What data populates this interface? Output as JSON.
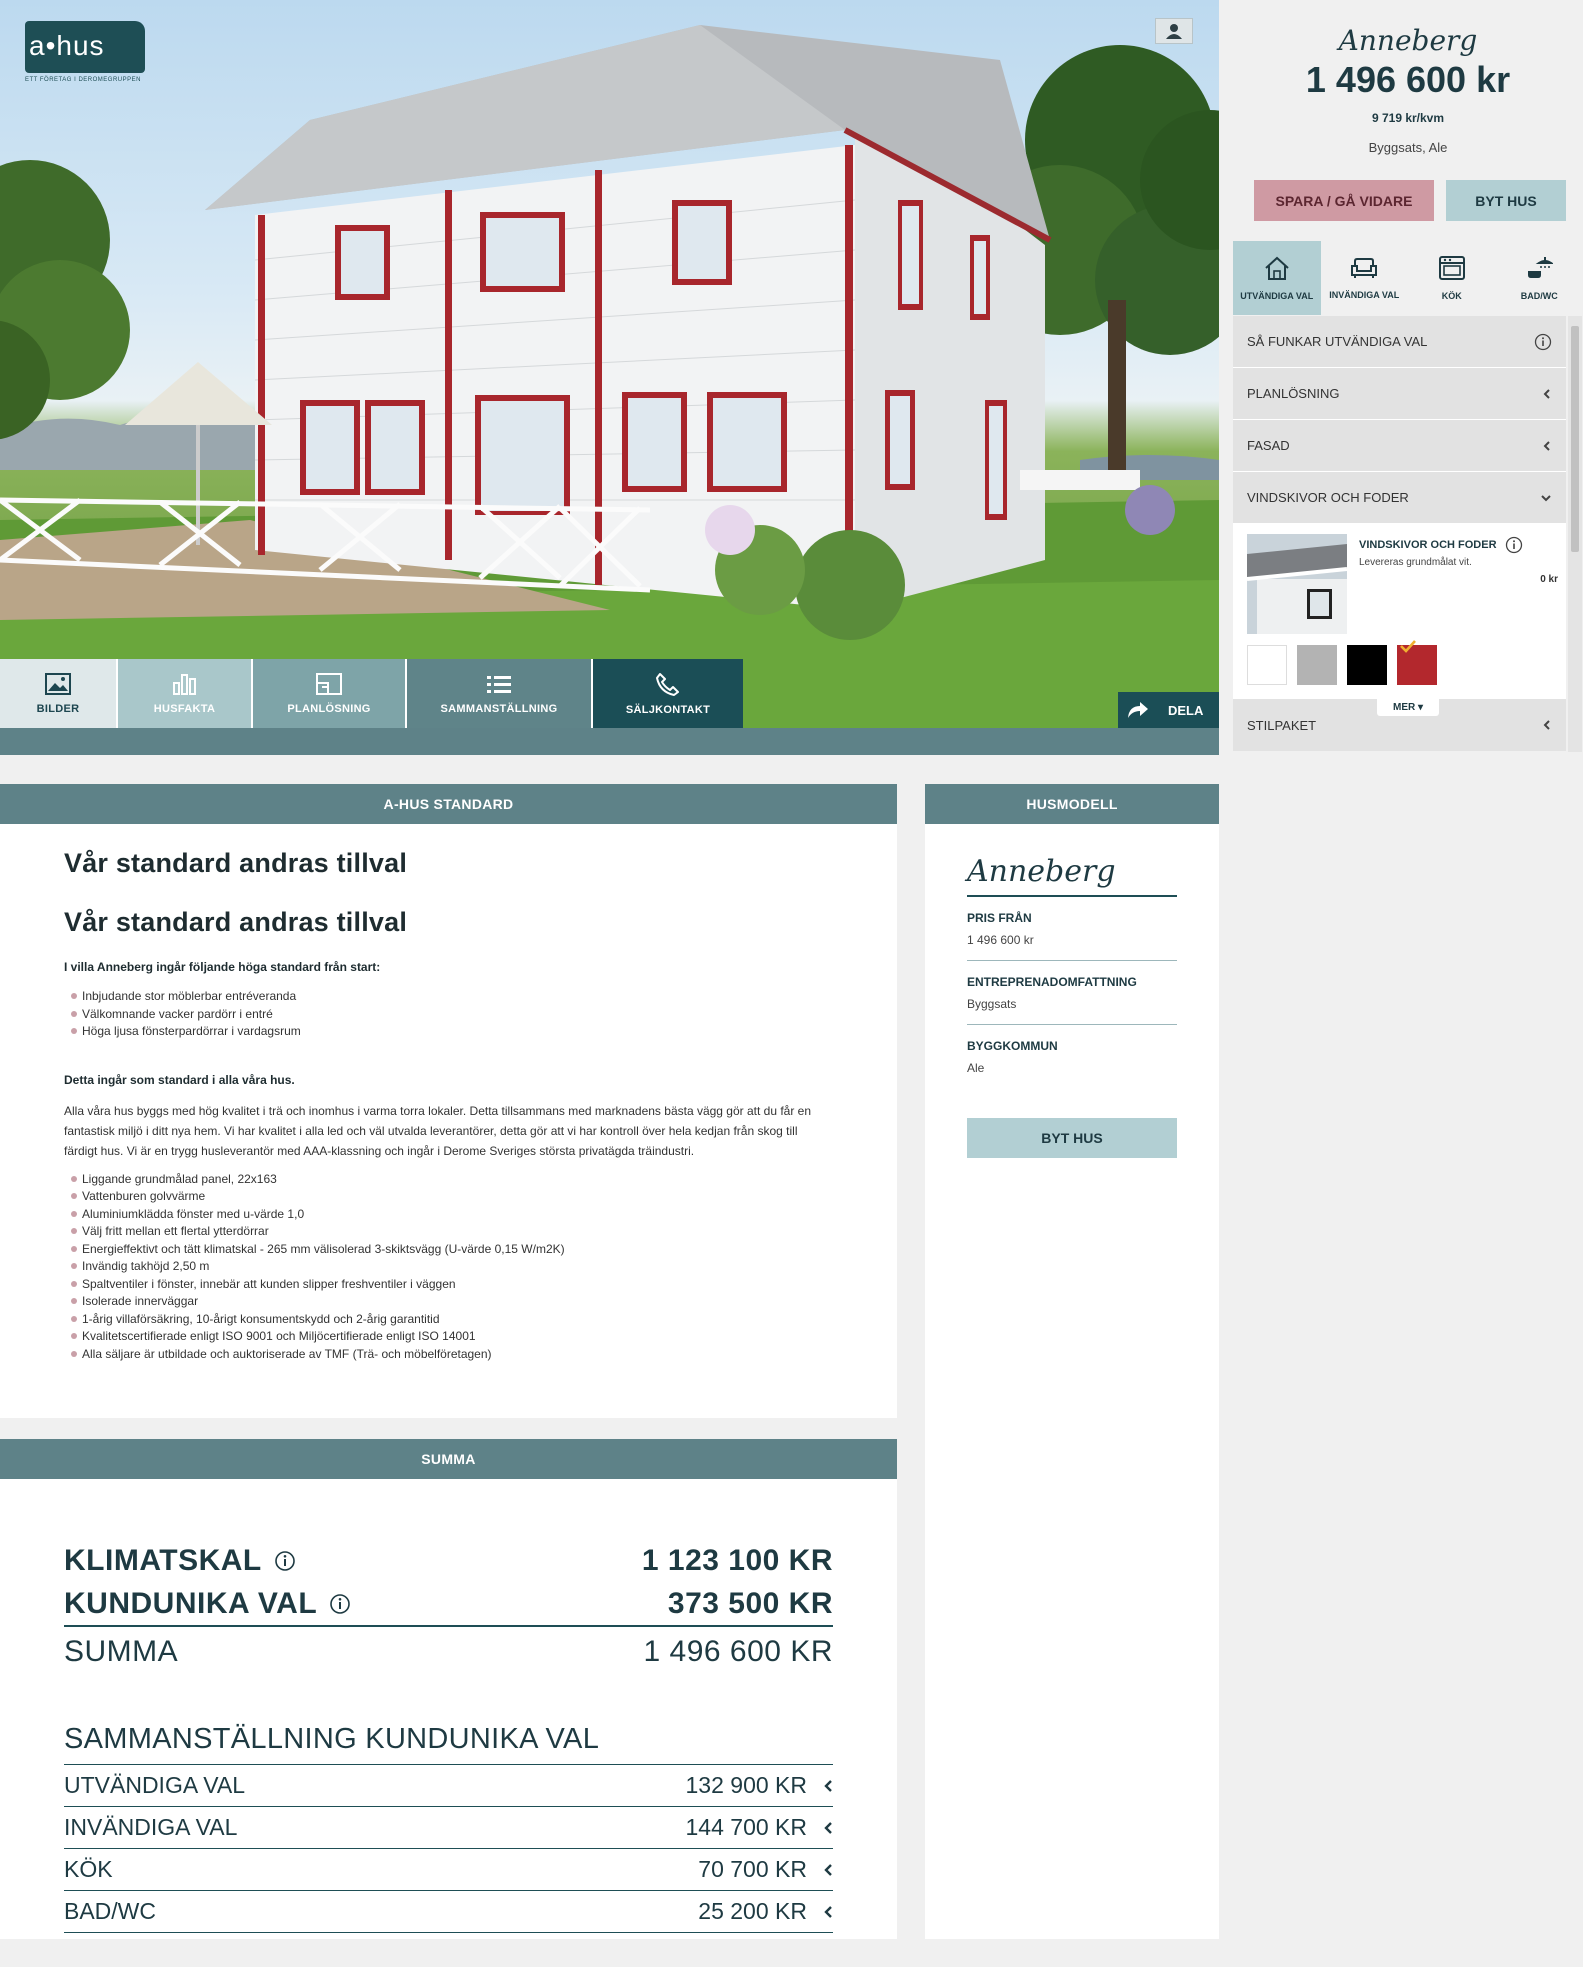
{
  "brand": {
    "logo_text": "a•hus",
    "logo_tagline": "ETT FÖRETAG I DEROMEGRUPPEN"
  },
  "hero_tabs": [
    {
      "label": "BILDER",
      "icon": "image-icon"
    },
    {
      "label": "HUSFAKTA",
      "icon": "bar-chart-icon"
    },
    {
      "label": "PLANLÖSNING",
      "icon": "floorplan-icon"
    },
    {
      "label": "SAMMANSTÄLLNING",
      "icon": "list-icon"
    },
    {
      "label": "SÄLJKONTAKT",
      "icon": "phone-icon"
    }
  ],
  "share": {
    "label": "DELA",
    "icon": "share-arrow-icon"
  },
  "standard": {
    "header": "A-HUS STANDARD",
    "heading1": "Vår standard andras tillval",
    "heading2": "Vår standard andras tillval",
    "intro_bold": "I villa Anneberg ingår följande höga standard från start:",
    "intro_list": [
      "Inbjudande stor möblerbar entréveranda",
      "Välkomnande vacker pardörr i entré",
      "Höga ljusa fönsterpardörrar i vardagsrum"
    ],
    "std_bold": "Detta ingår som standard i alla våra hus.",
    "paragraph": "Alla våra hus byggs med hög kvalitet i trä och inomhus i varma torra lokaler. Detta tillsammans med marknadens bästa vägg gör att du får en fantastisk miljö i ditt nya hem. Vi har kvalitet i alla led och väl utvalda leverantörer, detta gör att vi har kontroll över hela kedjan från skog till färdigt hus. Vi är en trygg husleverantör med AAA-klassning och ingår i Derome Sveriges största privatägda träindustri.",
    "std_list": [
      "Liggande grundmålad panel, 22x163",
      "Vattenburen golvvärme",
      "Aluminiumklädda fönster med u-värde 1,0",
      "Välj fritt mellan ett flertal ytterdörrar",
      "Energieffektivt och tätt klimatskal - 265 mm välisolerad 3-skiktsvägg (U-värde 0,15 W/m2K)",
      "Invändig takhöjd 2,50 m",
      "Spaltventiler i fönster, innebär att kunden slipper freshventiler i väggen",
      "Isolerade innerväggar",
      "1-årig villaförsäkring, 10-årigt konsumentskydd och 2-årig garantitid",
      "Kvalitetscertifierade enligt ISO 9001 och Miljöcertifierade enligt ISO 14001",
      "Alla säljare är utbildade och auktoriserade av TMF (Trä- och möbelföretagen)"
    ]
  },
  "husmodell": {
    "header": "HUSMODELL",
    "name": "Anneberg",
    "pris_label": "PRIS FRÅN",
    "pris_value": "1 496 600 kr",
    "entre_label": "ENTREPRENADOMFATTNING",
    "entre_value": "Byggsats",
    "kommun_label": "BYGGKOMMUN",
    "kommun_value": "Ale",
    "button": "BYT HUS"
  },
  "summa": {
    "header": "SUMMA",
    "klimatskal_label": "KLIMATSKAL",
    "klimatskal_value": "1 123 100 KR",
    "kundunika_label": "KUNDUNIKA VAL",
    "kundunika_value": "373 500 KR",
    "summa_label": "SUMMA",
    "summa_value": "1 496 600 KR",
    "breakdown_title": "SAMMANSTÄLLNING KUNDUNIKA VAL",
    "breakdown": [
      {
        "label": "UTVÄNDIGA VAL",
        "value": "132 900 KR"
      },
      {
        "label": "INVÄNDIGA VAL",
        "value": "144 700 KR"
      },
      {
        "label": "KÖK",
        "value": "70 700 KR"
      },
      {
        "label": "BAD/WC",
        "value": "25 200 KR"
      }
    ]
  },
  "sidebar": {
    "name": "Anneberg",
    "price": "1 496 600 kr",
    "per_kvm": "9 719 kr/kvm",
    "location": "Byggsats, Ale",
    "btn_spara": "SPARA / GÅ VIDARE",
    "btn_byt": "BYT HUS",
    "tabs": [
      {
        "label": "UTVÄNDIGA VAL",
        "icon": "house-icon"
      },
      {
        "label": "INVÄNDIGA VAL",
        "icon": "sofa-icon"
      },
      {
        "label": "KÖK",
        "icon": "oven-icon"
      },
      {
        "label": "BAD/WC",
        "icon": "shower-icon"
      }
    ],
    "accordion": [
      {
        "label": "SÅ FUNKAR UTVÄNDIGA VAL",
        "icon": "info-icon"
      },
      {
        "label": "PLANLÖSNING",
        "icon": "chevron-left-icon"
      },
      {
        "label": "FASAD",
        "icon": "chevron-left-icon"
      },
      {
        "label": "VINDSKIVOR OCH FODER",
        "icon": "chevron-down-icon"
      }
    ],
    "option": {
      "title": "VINDSKIVOR OCH FODER",
      "desc": "Levereras grundmålat vit.",
      "price": "0 kr",
      "swatches": [
        "#ffffff",
        "#b3b3b3",
        "#000000",
        "#b3282d"
      ],
      "selected_swatch": "#b3282d"
    },
    "stilpaket": {
      "label": "STILPAKET",
      "more": "MER ▾"
    }
  },
  "colors": {
    "teal_dark": "#1b4e56",
    "teal_mid": "#5e8288",
    "teal_light": "#b2cfd3",
    "rose": "#cf9aa3"
  }
}
